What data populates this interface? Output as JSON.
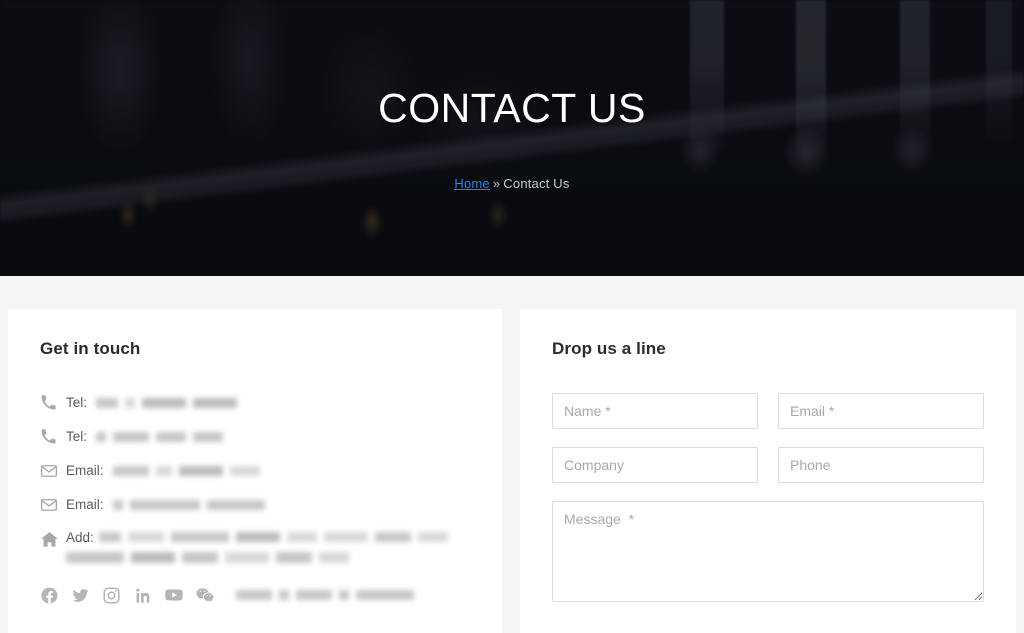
{
  "hero": {
    "title": "CONTACT US",
    "breadcrumb": {
      "home": "Home",
      "separator": "»",
      "current": "Contact Us"
    }
  },
  "contact_card": {
    "title": "Get in touch",
    "rows": [
      {
        "icon": "phone-icon",
        "label": "Tel:",
        "value_redacted": true
      },
      {
        "icon": "phone-icon",
        "label": "Tel:",
        "value_redacted": true
      },
      {
        "icon": "envelope-icon",
        "label": "Email:",
        "value_redacted": true
      },
      {
        "icon": "envelope-icon",
        "label": "Email:",
        "value_redacted": true
      },
      {
        "icon": "home-icon",
        "label": "Add:",
        "value_redacted": true
      }
    ],
    "social_icons": [
      "facebook-icon",
      "twitter-icon",
      "instagram-icon",
      "linkedin-icon",
      "youtube-icon",
      "wechat-icon"
    ],
    "social_trailing_redacted": true
  },
  "form_card": {
    "title": "Drop us a line",
    "fields": {
      "name": {
        "placeholder": "Name *",
        "value": ""
      },
      "email": {
        "placeholder": "Email *",
        "value": ""
      },
      "company": {
        "placeholder": "Company",
        "value": ""
      },
      "phone": {
        "placeholder": "Phone",
        "value": ""
      },
      "message": {
        "placeholder": "Message  *",
        "value": ""
      }
    }
  },
  "colors": {
    "link": "#2f80d6",
    "page_background": "#f5f5f5",
    "card_background": "#ffffff",
    "field_border": "#dcdcdc",
    "placeholder": "#a9a9a9",
    "icon_gray": "#a8a8a8"
  }
}
